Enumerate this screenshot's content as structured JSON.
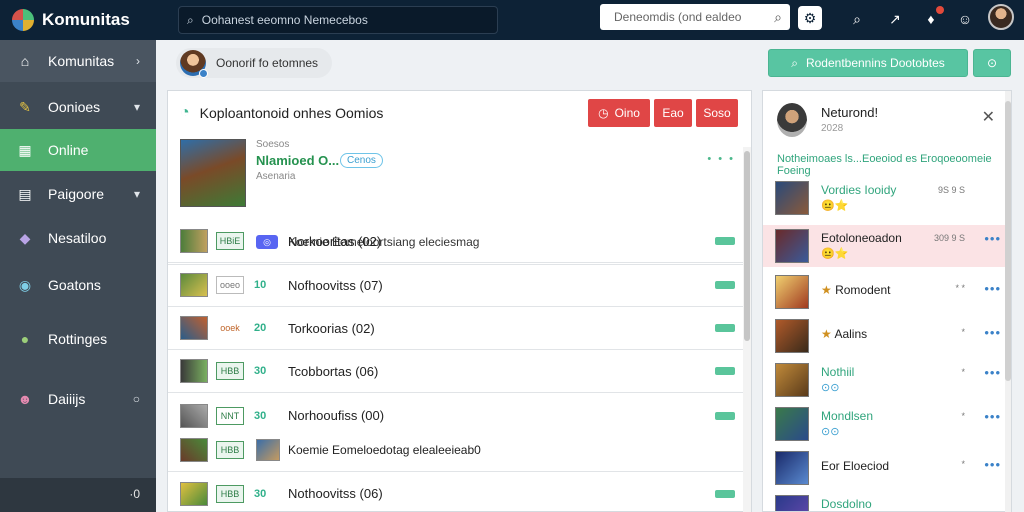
{
  "app": {
    "name": "Komunitas"
  },
  "topbar": {
    "search_main_text": "Oohanest eeomno Nemecebos",
    "search_secondary_text": "Deneomdis (ond ealdeo",
    "icons": [
      "search-icon",
      "gear-icon",
      "search-icon",
      "share-icon",
      "notification-icon",
      "help-icon",
      "avatar"
    ]
  },
  "sidebar": {
    "items": [
      {
        "label": "Komunitas",
        "icon": "home-icon",
        "right": "›"
      },
      {
        "label": "Oonioes",
        "icon": "pencil-icon",
        "right": "▾"
      },
      {
        "label": "Online",
        "icon": "grid-icon",
        "right": ""
      },
      {
        "label": "Paigoore",
        "icon": "calendar-icon",
        "right": "▾"
      },
      {
        "label": "Nesatiloo",
        "icon": "crystal-icon",
        "right": ""
      },
      {
        "label": "Goatons",
        "icon": "globe-icon",
        "right": ""
      },
      {
        "label": "Rottinges",
        "icon": "game-icon",
        "right": ""
      },
      {
        "label": "Daiiijs",
        "icon": "character-icon",
        "right": "○"
      }
    ],
    "footer_text": "·0"
  },
  "header": {
    "breadcrumb": "Oonorif fo etomnes",
    "primary_button": "Rodentbennins Dootobtes",
    "secondary_button": "⊙"
  },
  "main": {
    "title": "Koploantonoid onhes Oomios",
    "buttons": {
      "one": "Oino",
      "two": "Eao",
      "three": "Soso"
    },
    "featured": {
      "small_top": "Soesos",
      "title": "Nlamioed O...",
      "tag": "Cenos",
      "small_bottom": "Asenaria",
      "line": "Koemie Eomeloortsiang eleciesmag",
      "right_dots": "• • •"
    },
    "rows": [
      {
        "tag": "HBiE",
        "num": "",
        "label": "Norkooritas (02)"
      },
      {
        "tag": "ooeo",
        "num": "10",
        "label": "Nofhoovitss (07)"
      },
      {
        "tag": "ooek",
        "num": "20",
        "label": "Torkoorias (02)"
      },
      {
        "tag": "HBB",
        "num": "30",
        "label": "Tcobbortas (06)"
      },
      {
        "tag": "NNT",
        "num": "30",
        "label": "Norhooufiss (00)"
      },
      {
        "tag": "HBB",
        "num": "",
        "label": "Koemie Eomeloedotag elealeeieab0"
      },
      {
        "tag": "HBB",
        "num": "30",
        "label": "Nothoovitss (06)"
      }
    ]
  },
  "right_panel": {
    "title": "Neturond!",
    "subtitle": "2028",
    "banner": "Notheimoaes ls...Eoeoiod es Eroqoeoomeie Foeing",
    "rows": [
      {
        "name": "Vordies Iooidy",
        "emoji": "😐⭐",
        "meta": "9S  9 S",
        "dots": "",
        "green": true,
        "hl": false
      },
      {
        "name": "Eotoloneoadon",
        "emoji": "😐⭐",
        "meta": "309  9 S",
        "dots": "•••",
        "green": false,
        "hl": true
      },
      {
        "name": "Romodent",
        "emoji": "",
        "meta": "*   *",
        "dots": "•••",
        "green": false,
        "hl": false
      },
      {
        "name": "Aalins",
        "emoji": "",
        "meta": "*",
        "dots": "•••",
        "green": false,
        "hl": false
      },
      {
        "name": "Nothiil",
        "emoji": "⊙⊙",
        "meta": "*",
        "dots": "•••",
        "green": true,
        "hl": false
      },
      {
        "name": "Mondlsen",
        "emoji": "⊙⊙",
        "meta": "*",
        "dots": "•••",
        "green": true,
        "hl": false
      },
      {
        "name": "Eor Eloeciod",
        "emoji": "",
        "meta": "*",
        "dots": "•••",
        "green": false,
        "hl": false
      },
      {
        "name": "Dosdolno",
        "emoji": "",
        "meta": "",
        "dots": "",
        "green": true,
        "hl": false
      }
    ]
  }
}
